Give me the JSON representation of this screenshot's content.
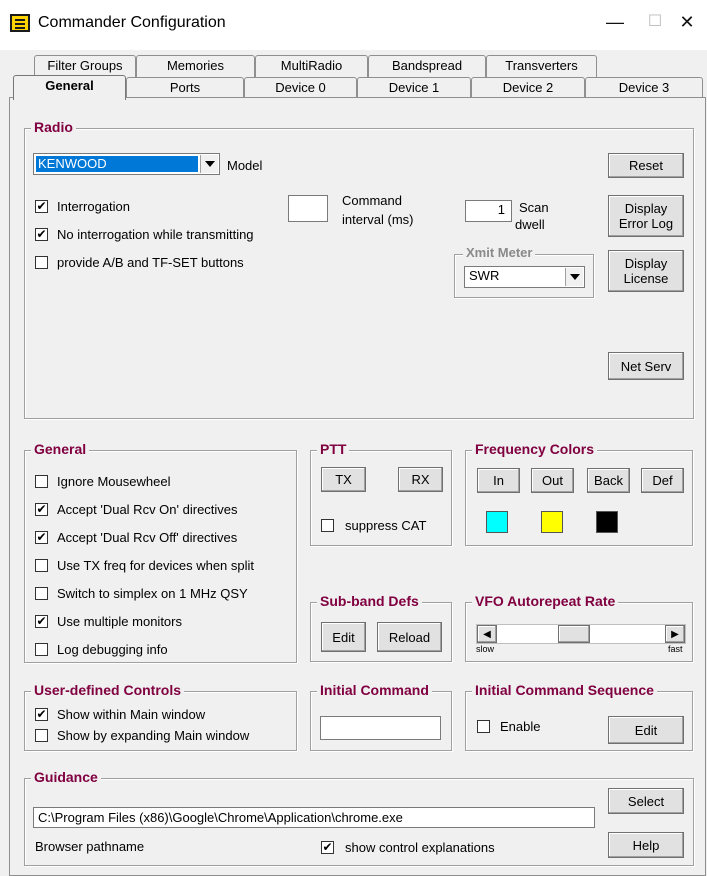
{
  "window": {
    "title": "Commander Configuration",
    "minimize": "—",
    "maximize": "☐",
    "close": "✕"
  },
  "tabs_row1": [
    "Filter Groups",
    "Memories",
    "MultiRadio",
    "Bandspread",
    "Transverters"
  ],
  "tabs_row2": [
    "General",
    "Ports",
    "Device 0",
    "Device 1",
    "Device 2",
    "Device 3"
  ],
  "active_tab": "General",
  "radio": {
    "title": "Radio",
    "model_value": "KENWOOD",
    "model_label": "Model",
    "interrogation": {
      "label": "Interrogation",
      "checked": true
    },
    "no_interrogation_tx": {
      "label": "No interrogation while transmitting",
      "checked": true
    },
    "ab_buttons": {
      "label": "provide A/B and TF-SET buttons",
      "checked": false
    },
    "command_interval_value": "",
    "command_interval_label1": "Command",
    "command_interval_label2": "interval (ms)",
    "scan_dwell_value": "1",
    "scan_dwell_label1": "Scan",
    "scan_dwell_label2": "dwell",
    "xmit_meter_title": "Xmit Meter",
    "xmit_meter_value": "SWR",
    "reset": "Reset",
    "display_error_log1": "Display",
    "display_error_log2": "Error Log",
    "display_license1": "Display",
    "display_license2": "License",
    "net_serv": "Net Serv"
  },
  "general": {
    "title": "General",
    "items": [
      {
        "label": "Ignore Mousewheel",
        "checked": false
      },
      {
        "label": "Accept 'Dual Rcv On' directives",
        "checked": true
      },
      {
        "label": "Accept 'Dual Rcv Off' directives",
        "checked": true
      },
      {
        "label": "Use TX freq for devices when split",
        "checked": false
      },
      {
        "label": "Switch to simplex on 1 MHz QSY",
        "checked": false
      },
      {
        "label": "Use multiple monitors",
        "checked": true
      },
      {
        "label": "Log debugging info",
        "checked": false
      }
    ]
  },
  "ptt": {
    "title": "PTT",
    "tx": "TX",
    "rx": "RX",
    "suppress_cat": {
      "label": "suppress CAT",
      "checked": false
    }
  },
  "frequency_colors": {
    "title": "Frequency Colors",
    "buttons": [
      "In",
      "Out",
      "Back",
      "Def"
    ],
    "swatches": [
      "#00ffff",
      "#ffff00",
      "#000000"
    ]
  },
  "subband": {
    "title": "Sub-band Defs",
    "edit": "Edit",
    "reload": "Reload"
  },
  "vfo": {
    "title": "VFO Autorepeat Rate",
    "slow": "slow",
    "fast": "fast",
    "level": 0.45
  },
  "user_controls": {
    "title": "User-defined Controls",
    "show_within": {
      "label": "Show within Main window",
      "checked": true
    },
    "show_expanding": {
      "label": "Show by expanding Main window",
      "checked": false
    }
  },
  "initial_command": {
    "title": "Initial Command",
    "value": ""
  },
  "initial_sequence": {
    "title": "Initial Command Sequence",
    "enable": {
      "label": "Enable",
      "checked": false
    },
    "edit": "Edit"
  },
  "guidance": {
    "title": "Guidance",
    "path_value": "C:\\Program Files (x86)\\Google\\Chrome\\Application\\chrome.exe",
    "browser_label": "Browser pathname",
    "select": "Select",
    "help": "Help",
    "show_explanations": {
      "label": "show control explanations",
      "checked": true
    }
  }
}
